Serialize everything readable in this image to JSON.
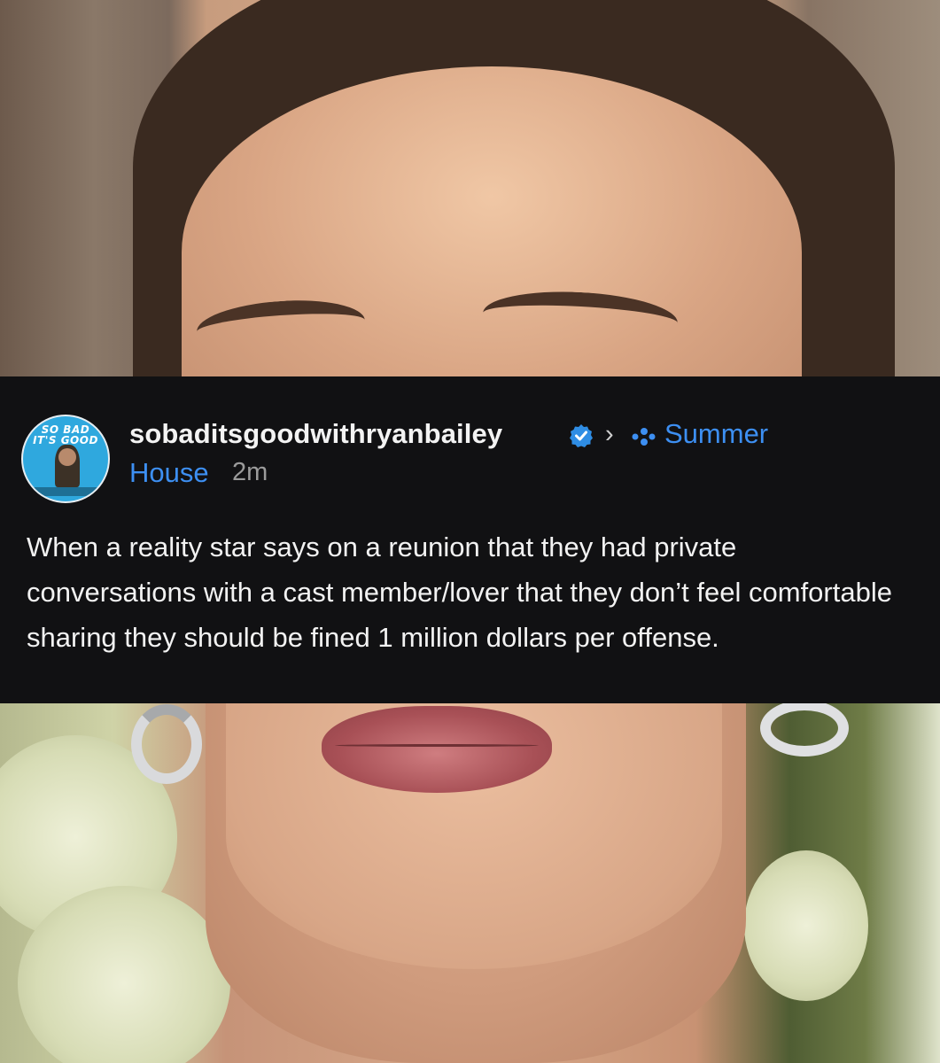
{
  "post": {
    "avatar_text_line1": "SO BAD",
    "avatar_text_line2": "IT'S GOOD",
    "username": "sobaditsgoodwithryanbailey",
    "verified_icon": "verified-badge-icon",
    "separator": "›",
    "community_icon": "community-icon",
    "community_name_line1": "Summer",
    "community_name_line2": "House",
    "time_ago": "2m",
    "body": "When a reality star says on a reunion that they had private conversations with a cast member/lover that they don’t feel comfortable sharing they should be fined 1 million dollars per offense."
  },
  "colors": {
    "card_background": "#111113",
    "username": "#f3f3f3",
    "community": "#3d8ff2",
    "verified": "#2f8de4",
    "timestamp": "#9b9b9b"
  }
}
